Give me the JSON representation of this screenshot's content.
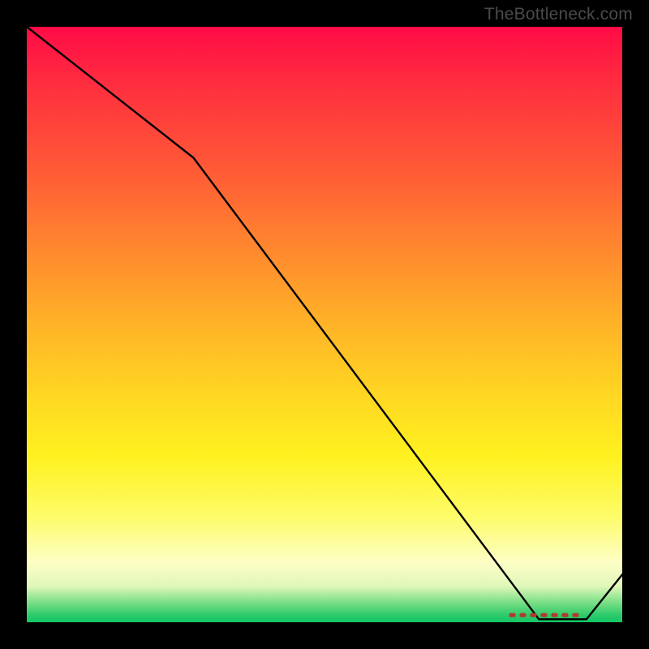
{
  "attribution": "TheBottleneck.com",
  "chart_data": {
    "type": "line",
    "title": "",
    "xlabel": "",
    "ylabel": "",
    "xlim": [
      0,
      100
    ],
    "ylim": [
      0,
      100
    ],
    "series": [
      {
        "name": "curve",
        "x": [
          0,
          28,
          86,
          88,
          94,
          100
        ],
        "y": [
          100,
          78,
          0.5,
          0.5,
          0.5,
          8
        ]
      }
    ],
    "markers": {
      "name": "dash-band",
      "color": "#b13a2e",
      "x_start": 81,
      "x_end": 93,
      "y": 1.2
    },
    "background_gradient": {
      "top": "#ff0b46",
      "mid_upper": "#ff8a2e",
      "mid": "#ffd722",
      "mid_lower": "#fdfec6",
      "bottom": "#15c765"
    }
  }
}
